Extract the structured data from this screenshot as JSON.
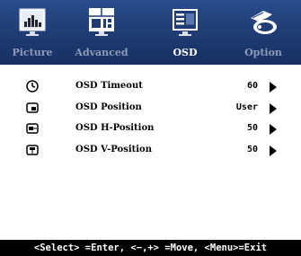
{
  "tabs": [
    {
      "label": "Picture",
      "icon": "picture-icon",
      "active": false
    },
    {
      "label": "Advanced",
      "icon": "advanced-icon",
      "active": false
    },
    {
      "label": "OSD",
      "icon": "osd-icon",
      "active": true
    },
    {
      "label": "Option",
      "icon": "option-icon",
      "active": false
    }
  ],
  "items": [
    {
      "label": "OSD Timeout",
      "value": "60",
      "icon": "timer-icon"
    },
    {
      "label": "OSD Position",
      "value": "User",
      "icon": "position-icon"
    },
    {
      "label": "OSD H-Position",
      "value": "50",
      "icon": "h-position-icon"
    },
    {
      "label": "OSD V-Position",
      "value": "50",
      "icon": "v-position-icon"
    }
  ],
  "footer": "<Select> =Enter, <−,+> =Move, <Menu>=Exit",
  "colors": {
    "tab_bar": "#1f3c74",
    "active_label": "#ffffff",
    "inactive_label": "#8c9bb8"
  }
}
